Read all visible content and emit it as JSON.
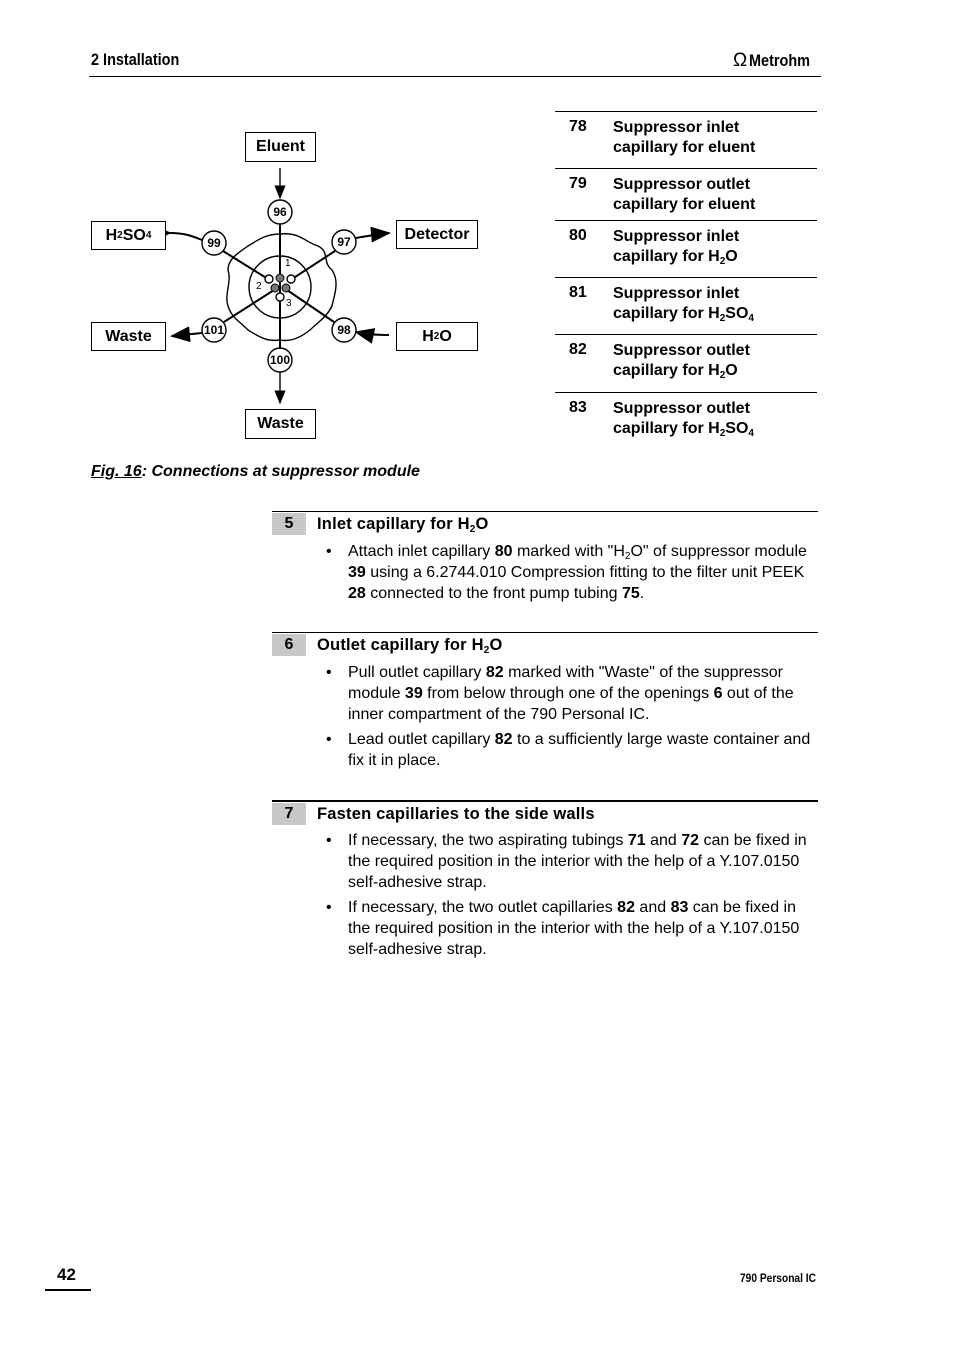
{
  "header": {
    "section": "2  Installation",
    "logo": "Metrohm"
  },
  "diagram": {
    "boxes": {
      "eluent": "Eluent",
      "detector": "Detector",
      "waste_left": "Waste",
      "waste_bottom": "Waste",
      "h2so4": [
        "H",
        "2",
        "SO",
        "4"
      ],
      "h2o": [
        "H",
        "2",
        "O"
      ]
    },
    "connectors": [
      "96",
      "97",
      "98",
      "99",
      "100",
      "101"
    ],
    "ports": [
      "1",
      "2",
      "3"
    ]
  },
  "legend": [
    {
      "num": "78",
      "l1": "Suppressor inlet",
      "l2": [
        "capillary for eluent"
      ]
    },
    {
      "num": "79",
      "l1": "Suppressor outlet",
      "l2": [
        "capillary for eluent"
      ]
    },
    {
      "num": "80",
      "l1": "Suppressor inlet",
      "l2": [
        "capillary for H",
        "2",
        "O"
      ]
    },
    {
      "num": "81",
      "l1": "Suppressor inlet",
      "l2": [
        "capillary for H",
        "2",
        "SO",
        "4"
      ]
    },
    {
      "num": "82",
      "l1": "Suppressor outlet",
      "l2": [
        "capillary for H",
        "2",
        "O"
      ]
    },
    {
      "num": "83",
      "l1": "Suppressor outlet",
      "l2": [
        "capillary for H",
        "2",
        "SO",
        "4"
      ]
    }
  ],
  "caption": {
    "label": "Fig. 16",
    "text": ":  Connections at suppressor module"
  },
  "steps": [
    {
      "num": "5",
      "title": [
        "Inlet capillary for H",
        "2",
        "O"
      ],
      "bullets": [
        [
          "Attach inlet capillary ",
          "80",
          " marked with \"H",
          "2",
          "O\" of suppressor module ",
          "39",
          " using a 6.2744.010 Compression fitting to the filter unit PEEK ",
          "28",
          " connected to the front pump tubing ",
          "75",
          "."
        ]
      ]
    },
    {
      "num": "6",
      "title": [
        "Outlet capillary for H",
        "2",
        "O"
      ],
      "bullets": [
        [
          "Pull outlet capillary ",
          "82",
          " marked with \"Waste\" of the suppressor module ",
          "39",
          " from below through one of the openings ",
          "6",
          " out of the inner compartment of the 790 Personal IC."
        ],
        [
          "Lead outlet capillary ",
          "82",
          " to a sufficiently large waste container and fix it in place."
        ]
      ]
    },
    {
      "num": "7",
      "title": [
        "Fasten capillaries to the side walls"
      ],
      "bullets": [
        [
          "If necessary, the two aspirating tubings ",
          "71",
          " and ",
          "72",
          " can be fixed in the required position in the interior with the help of a Y.107.0150 self-adhesive strap."
        ],
        [
          "If necessary, the two outlet capillaries ",
          "82",
          " and ",
          "83",
          " can be fixed in the required position in the interior with the help of a Y.107.0150 self-adhesive strap."
        ]
      ]
    }
  ],
  "footer": {
    "page": "42",
    "product": "790 Personal IC"
  }
}
